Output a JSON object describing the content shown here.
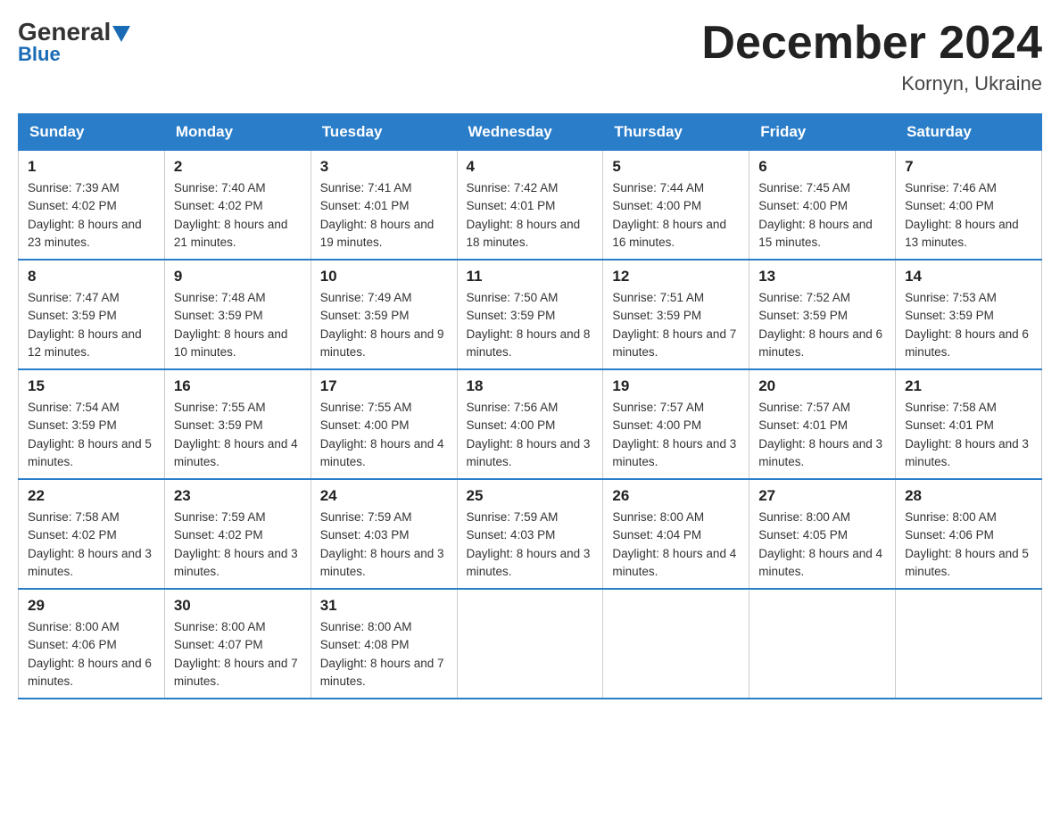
{
  "logo": {
    "general": "General",
    "blue": "Blue"
  },
  "title": "December 2024",
  "location": "Kornyn, Ukraine",
  "days_of_week": [
    "Sunday",
    "Monday",
    "Tuesday",
    "Wednesday",
    "Thursday",
    "Friday",
    "Saturday"
  ],
  "weeks": [
    [
      {
        "day": "1",
        "sunrise": "7:39 AM",
        "sunset": "4:02 PM",
        "daylight": "8 hours and 23 minutes."
      },
      {
        "day": "2",
        "sunrise": "7:40 AM",
        "sunset": "4:02 PM",
        "daylight": "8 hours and 21 minutes."
      },
      {
        "day": "3",
        "sunrise": "7:41 AM",
        "sunset": "4:01 PM",
        "daylight": "8 hours and 19 minutes."
      },
      {
        "day": "4",
        "sunrise": "7:42 AM",
        "sunset": "4:01 PM",
        "daylight": "8 hours and 18 minutes."
      },
      {
        "day": "5",
        "sunrise": "7:44 AM",
        "sunset": "4:00 PM",
        "daylight": "8 hours and 16 minutes."
      },
      {
        "day": "6",
        "sunrise": "7:45 AM",
        "sunset": "4:00 PM",
        "daylight": "8 hours and 15 minutes."
      },
      {
        "day": "7",
        "sunrise": "7:46 AM",
        "sunset": "4:00 PM",
        "daylight": "8 hours and 13 minutes."
      }
    ],
    [
      {
        "day": "8",
        "sunrise": "7:47 AM",
        "sunset": "3:59 PM",
        "daylight": "8 hours and 12 minutes."
      },
      {
        "day": "9",
        "sunrise": "7:48 AM",
        "sunset": "3:59 PM",
        "daylight": "8 hours and 10 minutes."
      },
      {
        "day": "10",
        "sunrise": "7:49 AM",
        "sunset": "3:59 PM",
        "daylight": "8 hours and 9 minutes."
      },
      {
        "day": "11",
        "sunrise": "7:50 AM",
        "sunset": "3:59 PM",
        "daylight": "8 hours and 8 minutes."
      },
      {
        "day": "12",
        "sunrise": "7:51 AM",
        "sunset": "3:59 PM",
        "daylight": "8 hours and 7 minutes."
      },
      {
        "day": "13",
        "sunrise": "7:52 AM",
        "sunset": "3:59 PM",
        "daylight": "8 hours and 6 minutes."
      },
      {
        "day": "14",
        "sunrise": "7:53 AM",
        "sunset": "3:59 PM",
        "daylight": "8 hours and 6 minutes."
      }
    ],
    [
      {
        "day": "15",
        "sunrise": "7:54 AM",
        "sunset": "3:59 PM",
        "daylight": "8 hours and 5 minutes."
      },
      {
        "day": "16",
        "sunrise": "7:55 AM",
        "sunset": "3:59 PM",
        "daylight": "8 hours and 4 minutes."
      },
      {
        "day": "17",
        "sunrise": "7:55 AM",
        "sunset": "4:00 PM",
        "daylight": "8 hours and 4 minutes."
      },
      {
        "day": "18",
        "sunrise": "7:56 AM",
        "sunset": "4:00 PM",
        "daylight": "8 hours and 3 minutes."
      },
      {
        "day": "19",
        "sunrise": "7:57 AM",
        "sunset": "4:00 PM",
        "daylight": "8 hours and 3 minutes."
      },
      {
        "day": "20",
        "sunrise": "7:57 AM",
        "sunset": "4:01 PM",
        "daylight": "8 hours and 3 minutes."
      },
      {
        "day": "21",
        "sunrise": "7:58 AM",
        "sunset": "4:01 PM",
        "daylight": "8 hours and 3 minutes."
      }
    ],
    [
      {
        "day": "22",
        "sunrise": "7:58 AM",
        "sunset": "4:02 PM",
        "daylight": "8 hours and 3 minutes."
      },
      {
        "day": "23",
        "sunrise": "7:59 AM",
        "sunset": "4:02 PM",
        "daylight": "8 hours and 3 minutes."
      },
      {
        "day": "24",
        "sunrise": "7:59 AM",
        "sunset": "4:03 PM",
        "daylight": "8 hours and 3 minutes."
      },
      {
        "day": "25",
        "sunrise": "7:59 AM",
        "sunset": "4:03 PM",
        "daylight": "8 hours and 3 minutes."
      },
      {
        "day": "26",
        "sunrise": "8:00 AM",
        "sunset": "4:04 PM",
        "daylight": "8 hours and 4 minutes."
      },
      {
        "day": "27",
        "sunrise": "8:00 AM",
        "sunset": "4:05 PM",
        "daylight": "8 hours and 4 minutes."
      },
      {
        "day": "28",
        "sunrise": "8:00 AM",
        "sunset": "4:06 PM",
        "daylight": "8 hours and 5 minutes."
      }
    ],
    [
      {
        "day": "29",
        "sunrise": "8:00 AM",
        "sunset": "4:06 PM",
        "daylight": "8 hours and 6 minutes."
      },
      {
        "day": "30",
        "sunrise": "8:00 AM",
        "sunset": "4:07 PM",
        "daylight": "8 hours and 7 minutes."
      },
      {
        "day": "31",
        "sunrise": "8:00 AM",
        "sunset": "4:08 PM",
        "daylight": "8 hours and 7 minutes."
      },
      null,
      null,
      null,
      null
    ]
  ]
}
